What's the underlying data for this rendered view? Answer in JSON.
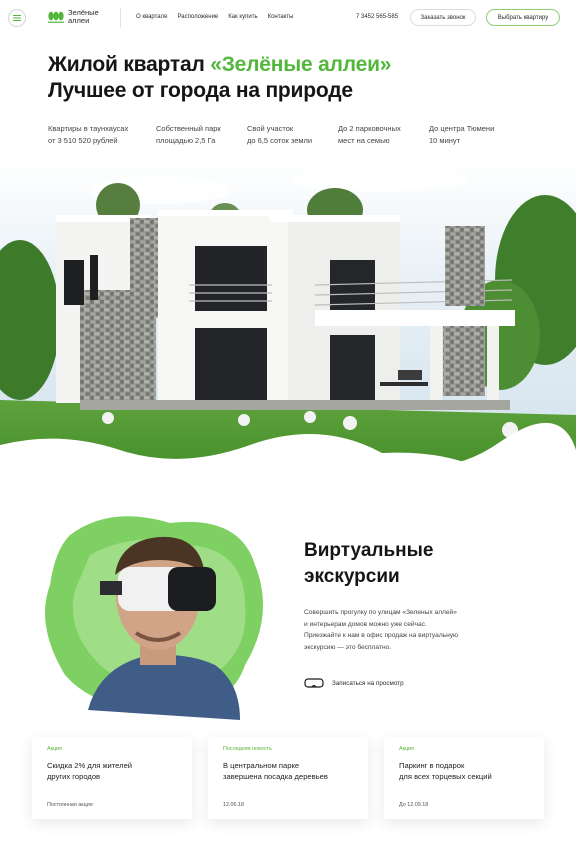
{
  "header": {
    "logo_text": "Зелёные аллеи",
    "nav": [
      "О квартале",
      "Расположение",
      "Как купить",
      "Контакты"
    ],
    "phone": "7 3452 565-585",
    "call_button": "Заказать звонок",
    "choose_button": "Выбрать квартиру"
  },
  "hero": {
    "title_prefix": "Жилой квартал ",
    "title_accent": "«Зелёные аллеи»",
    "title_line2": "Лучшее от города на природе",
    "facts": [
      {
        "line1": "Квартиры в таунхаусах",
        "line2": "от 3 510 520 рублей"
      },
      {
        "line1": "Собственный парк",
        "line2": "площадью 2,5 Га"
      },
      {
        "line1": "Свой участок",
        "line2": "до 6,5 соток земли"
      },
      {
        "line1": "До 2 парковочных",
        "line2": "мест на семью"
      },
      {
        "line1": "До центра Тюмени",
        "line2": "10 минут"
      }
    ]
  },
  "vr": {
    "title_line1": "Виртуальные",
    "title_line2": "экскурсии",
    "text_lines": [
      "Совершить прогулку по улицам «Зеленых аллей»",
      "и интерьерам домов можно уже сейчас.",
      "Приезжайте к нам в офис продаж на виртуальную",
      "экскурсию — это бесплатно."
    ],
    "link": "Записаться на просмотр"
  },
  "cards": [
    {
      "tag": "Акция",
      "title_line1": "Скидка 2% для жителей",
      "title_line2": "других городов",
      "foot": "Постоянная акция"
    },
    {
      "tag": "Последняя новость",
      "title_line1": "В центральном парке",
      "title_line2": "завершена посадка деревьев",
      "foot": "12.06.18"
    },
    {
      "tag": "Акция",
      "title_line1": "Паркинг в подарок",
      "title_line2": "для всех торцевых секций",
      "foot": "До 12.09.18"
    }
  ],
  "colors": {
    "accent": "#52b73b",
    "text": "#151515",
    "muted": "#444444"
  },
  "icons": [
    "menu-icon",
    "logo-trees-icon",
    "vr-headset-icon"
  ]
}
